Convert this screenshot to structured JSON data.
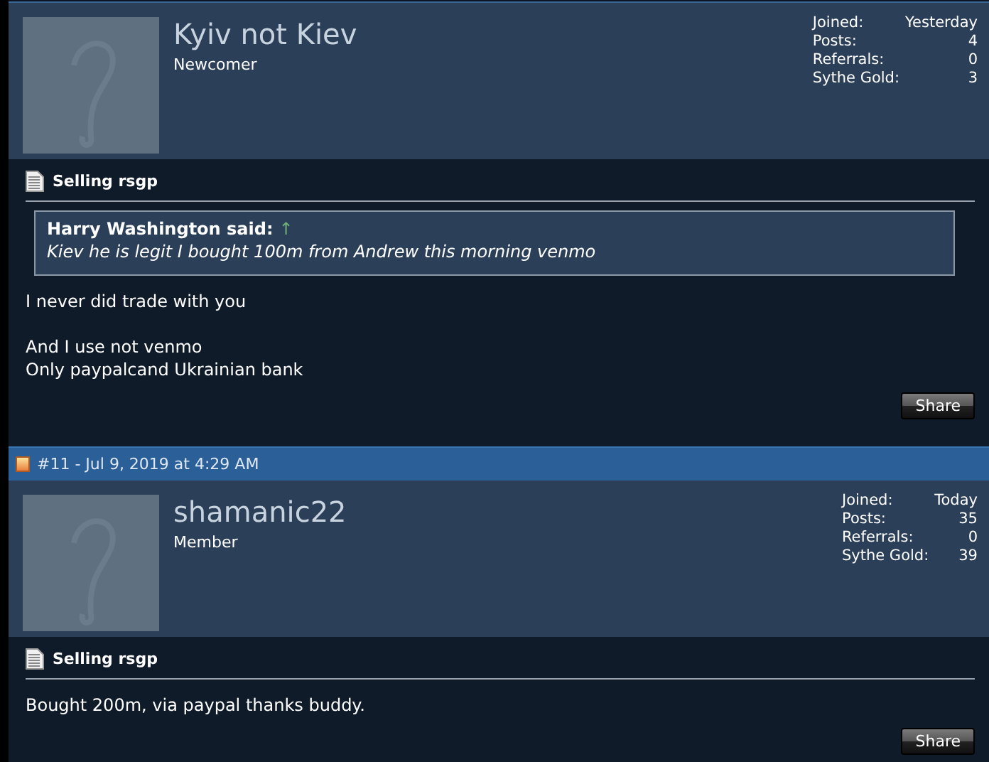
{
  "posts": [
    {
      "user": {
        "name": "Kyiv not Kiev",
        "rank": "Newcomer"
      },
      "stats": [
        {
          "label": "Joined:",
          "value": "Yesterday"
        },
        {
          "label": "Posts:",
          "value": "4"
        },
        {
          "label": "Referrals:",
          "value": "0"
        },
        {
          "label": "Sythe Gold:",
          "value": "3"
        }
      ],
      "title": "Selling rsgp",
      "quote": {
        "author": "Harry Washington said:",
        "link": "↑",
        "text": "Kiev he is legit I bought 100m from Andrew this morning venmo"
      },
      "paragraphs": [
        {
          "lines": [
            "I never did trade with you"
          ]
        },
        {
          "lines": [
            "And I use not venmo",
            "Only paypalcand Ukrainian bank"
          ]
        }
      ],
      "share": "Share"
    },
    {
      "header": "#11 - Jul 9, 2019 at 4:29 AM",
      "user": {
        "name": "shamanic22",
        "rank": "Member"
      },
      "stats": [
        {
          "label": "Joined:",
          "value": "Today"
        },
        {
          "label": "Posts:",
          "value": "35"
        },
        {
          "label": "Referrals:",
          "value": "0"
        },
        {
          "label": "Sythe Gold:",
          "value": "39"
        }
      ],
      "title": "Selling rsgp",
      "paragraphs": [
        {
          "lines": [
            "Bought 200m, via paypal thanks buddy."
          ]
        }
      ],
      "share": "Share"
    }
  ]
}
